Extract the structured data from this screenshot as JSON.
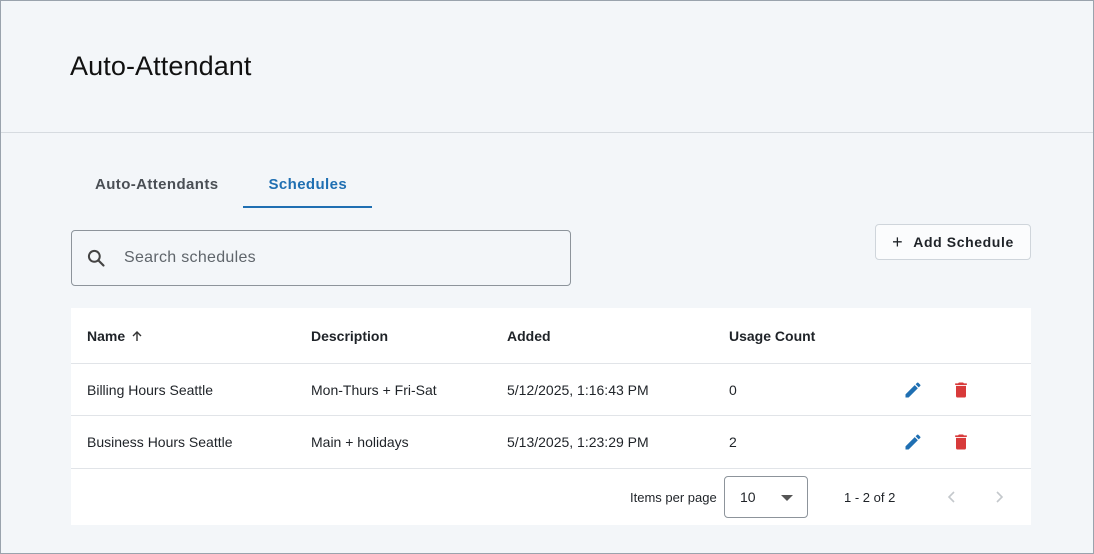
{
  "page": {
    "title": "Auto-Attendant"
  },
  "tabs": [
    {
      "label": "Auto-Attendants",
      "active": false
    },
    {
      "label": "Schedules",
      "active": true
    }
  ],
  "search": {
    "placeholder": "Search schedules",
    "value": ""
  },
  "toolbar": {
    "add_label": "Add Schedule",
    "add_icon": "plus-icon"
  },
  "table": {
    "columns": [
      "Name",
      "Description",
      "Added",
      "Usage Count"
    ],
    "sort": {
      "column": "Name",
      "direction": "ascending"
    },
    "rows": [
      {
        "name": "Billing Hours Seattle",
        "description": "Mon-Thurs + Fri-Sat",
        "added": "5/12/2025, 1:16:43 PM",
        "usage": "0"
      },
      {
        "name": "Business Hours Seattle",
        "description": "Main + holidays",
        "added": "5/13/2025, 1:23:29 PM",
        "usage": "2"
      }
    ],
    "row_actions": [
      "edit-icon",
      "delete-icon"
    ]
  },
  "pagination": {
    "items_per_page_label": "Items per page",
    "items_per_page": "10",
    "range": "1 - 2 of 2"
  },
  "colors": {
    "accent": "#1f6fb2",
    "edit": "#1f6fb2",
    "delete": "#d83a3a",
    "background": "#f3f6f9"
  }
}
